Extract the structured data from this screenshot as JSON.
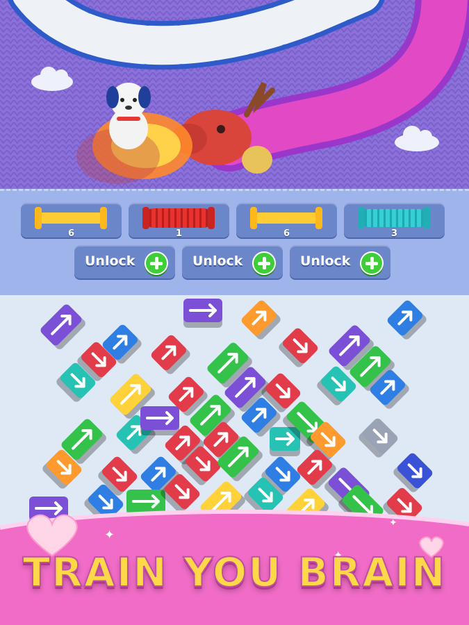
{
  "spool_slots": [
    {
      "color": "#ffcc33",
      "count": "6",
      "style": "spool"
    },
    {
      "color": "#e8322f",
      "count": "1",
      "style": "coil"
    },
    {
      "color": "#ffcc33",
      "count": "6",
      "style": "spool"
    },
    {
      "color": "#36cfd6",
      "count": "3",
      "style": "coil"
    }
  ],
  "unlock_buttons": [
    "Unlock",
    "Unlock",
    "Unlock"
  ],
  "banner": {
    "text": "TRAIN YOU BRAIN"
  },
  "colors": {
    "knit_background": "#8a6fd8",
    "slot_panel": "#9eb4ea",
    "board_background": "#dfe9f6",
    "banner_pink": "#f06cc6"
  }
}
